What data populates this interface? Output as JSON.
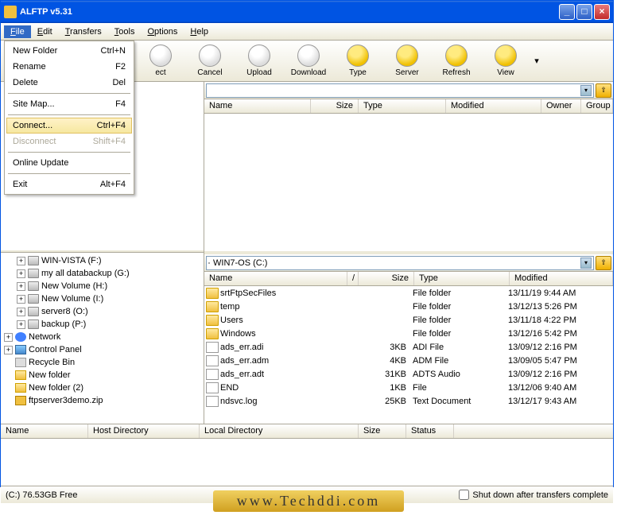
{
  "title": "ALFTP v5.31",
  "menubar": [
    "File",
    "Edit",
    "Transfers",
    "Tools",
    "Options",
    "Help"
  ],
  "filemenu": [
    {
      "label": "New Folder",
      "shortcut": "Ctrl+N"
    },
    {
      "label": "Rename",
      "shortcut": "F2"
    },
    {
      "label": "Delete",
      "shortcut": "Del"
    },
    {
      "sep": true
    },
    {
      "label": "Site Map...",
      "shortcut": "F4"
    },
    {
      "sep": true
    },
    {
      "label": "Connect...",
      "shortcut": "Ctrl+F4",
      "highlight": true
    },
    {
      "label": "Disconnect",
      "shortcut": "Shift+F4",
      "disabled": true
    },
    {
      "sep": true
    },
    {
      "label": "Online Update"
    },
    {
      "sep": true
    },
    {
      "label": "Exit",
      "shortcut": "Alt+F4"
    }
  ],
  "toolbar": [
    {
      "label": "ect",
      "cls": ""
    },
    {
      "label": "Cancel",
      "cls": ""
    },
    {
      "label": "Upload",
      "cls": ""
    },
    {
      "label": "Download",
      "cls": ""
    },
    {
      "label": "Type",
      "cls": "y"
    },
    {
      "label": "Server",
      "cls": "y"
    },
    {
      "label": "Refresh",
      "cls": "y"
    },
    {
      "label": "View",
      "cls": "y"
    }
  ],
  "remote_cols": [
    "Name",
    "Size",
    "Type",
    "Modified",
    "Owner",
    "Group"
  ],
  "local_path": "WIN7-OS (C:)",
  "local_cols": [
    "Name",
    "Size",
    "Type",
    "Modified"
  ],
  "local_files": [
    {
      "name": "srtFtpSecFiles",
      "size": "",
      "type": "File folder",
      "mod": "13/11/19 9:44 AM",
      "ic": "folder"
    },
    {
      "name": "temp",
      "size": "",
      "type": "File folder",
      "mod": "13/12/13 5:26 PM",
      "ic": "folder"
    },
    {
      "name": "Users",
      "size": "",
      "type": "File folder",
      "mod": "13/11/18 4:22 PM",
      "ic": "folder"
    },
    {
      "name": "Windows",
      "size": "",
      "type": "File folder",
      "mod": "13/12/16 5:42 PM",
      "ic": "folder"
    },
    {
      "name": "ads_err.adi",
      "size": "3KB",
      "type": "ADI File",
      "mod": "13/09/12 2:16 PM",
      "ic": "file"
    },
    {
      "name": "ads_err.adm",
      "size": "4KB",
      "type": "ADM File",
      "mod": "13/09/05 5:47 PM",
      "ic": "file"
    },
    {
      "name": "ads_err.adt",
      "size": "31KB",
      "type": "ADTS Audio",
      "mod": "13/09/12 2:16 PM",
      "ic": "file"
    },
    {
      "name": "END",
      "size": "1KB",
      "type": "File",
      "mod": "13/12/06 9:40 AM",
      "ic": "file"
    },
    {
      "name": "ndsvc.log",
      "size": "25KB",
      "type": "Text Document",
      "mod": "13/12/17 9:43 AM",
      "ic": "file"
    }
  ],
  "tree": [
    {
      "ind": 1,
      "exp": "+",
      "ic": "drive",
      "label": "WIN-VISTA (F:)"
    },
    {
      "ind": 1,
      "exp": "+",
      "ic": "drive",
      "label": "my all databackup (G:)"
    },
    {
      "ind": 1,
      "exp": "+",
      "ic": "drive",
      "label": "New Volume (H:)"
    },
    {
      "ind": 1,
      "exp": "+",
      "ic": "drive",
      "label": "New Volume (I:)"
    },
    {
      "ind": 1,
      "exp": "+",
      "ic": "drive",
      "label": "server8 (O:)"
    },
    {
      "ind": 1,
      "exp": "+",
      "ic": "drive",
      "label": "backup (P:)"
    },
    {
      "ind": 0,
      "exp": "+",
      "ic": "net",
      "label": "Network"
    },
    {
      "ind": 0,
      "exp": "+",
      "ic": "cp",
      "label": "Control Panel"
    },
    {
      "ind": 0,
      "exp": "",
      "ic": "bin",
      "label": "Recycle Bin"
    },
    {
      "ind": 0,
      "exp": "",
      "ic": "fold",
      "label": "New folder"
    },
    {
      "ind": 0,
      "exp": "",
      "ic": "fold",
      "label": "New folder (2)"
    },
    {
      "ind": 0,
      "exp": "",
      "ic": "zip",
      "label": "ftpserver3demo.zip"
    }
  ],
  "queue_cols": [
    "Name",
    "Host Directory",
    "Local Directory",
    "Size",
    "Status"
  ],
  "status_left": "(C:) 76.53GB Free",
  "status_right": "Shut down after transfers complete",
  "watermark": "www.Techddi.com"
}
